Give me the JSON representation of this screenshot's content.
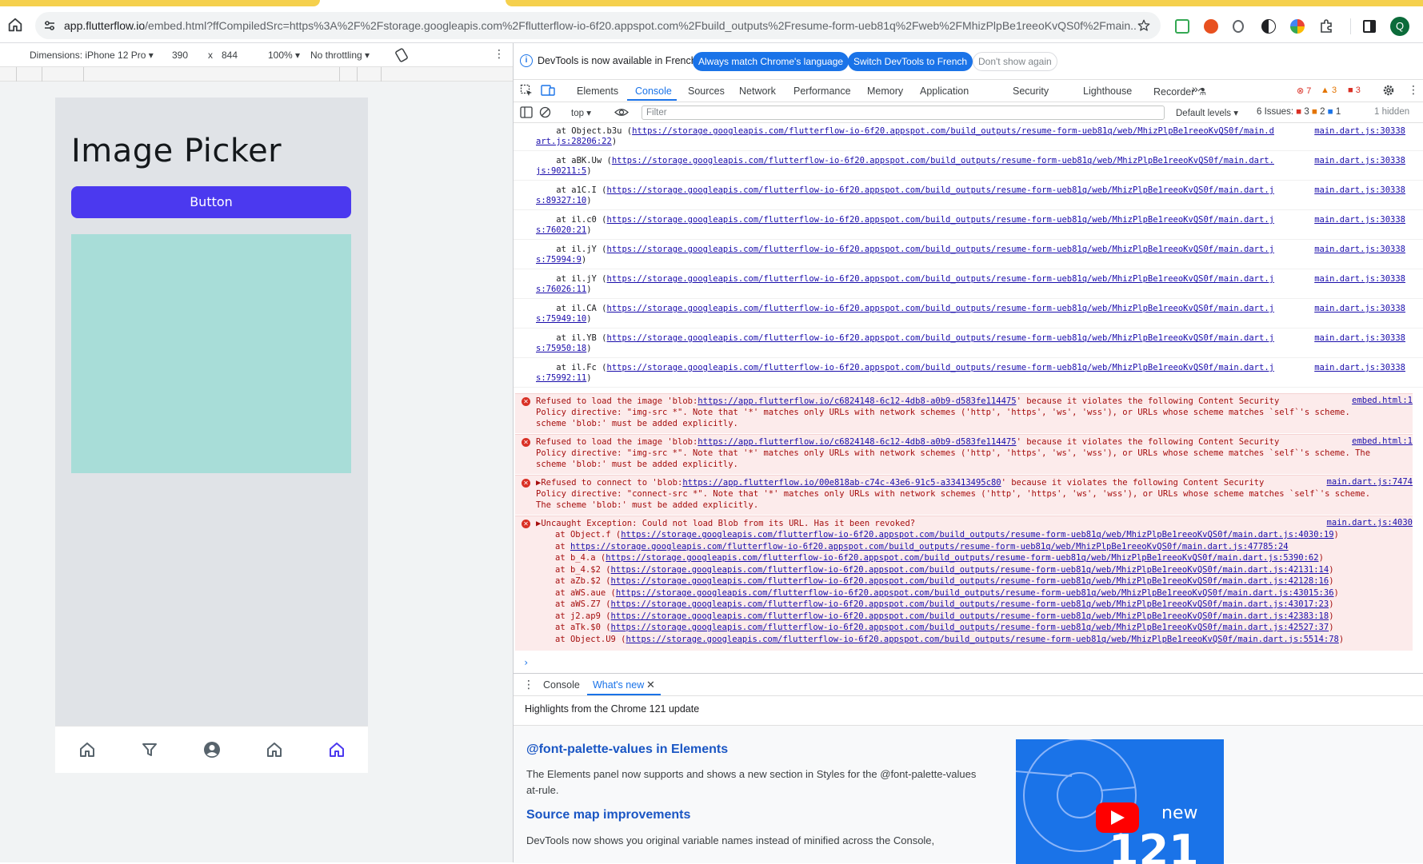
{
  "browser": {
    "url_host": "app.flutterflow.io",
    "url_rest": "/embed.html?ffCompiledSrc=https%3A%2F%2Fstorage.googleapis.com%2Fflutterflow-io-6f20.appspot.com%2Fbuild_outputs%2Fresume-form-ueb81q%2Fweb%2FMhizPlpBe1reeoKvQS0f%2Fmain....",
    "profile_initial": "Q"
  },
  "device_toolbar": {
    "dimensions_label": "Dimensions: iPhone 12 Pro",
    "width": "390",
    "times": "x",
    "height": "844",
    "zoom": "100%",
    "throttle": "No throttling"
  },
  "app": {
    "title": "Image Picker",
    "button_label": "Button",
    "nav_icons": [
      "home-icon",
      "filter-icon",
      "account-circle-icon",
      "home-icon",
      "home-icon"
    ],
    "accent_color": "#4b39ef",
    "image_bg": "#a8ddd8"
  },
  "devtools": {
    "info_message": "DevTools is now available in French!",
    "info_btn1": "Always match Chrome's language",
    "info_btn2": "Switch DevTools to French",
    "info_btn3": "Don't show again",
    "tabs": [
      "Elements",
      "Console",
      "Sources",
      "Network",
      "Performance",
      "Memory",
      "Application",
      "Security",
      "Lighthouse",
      "Recorder"
    ],
    "more_tabs": "»",
    "error_count": "7",
    "warning_count": "3",
    "issue_count": "3",
    "context": "top",
    "filter_placeholder": "Filter",
    "levels": "Default levels",
    "issues_label": "6 Issues:",
    "issues_err": "3",
    "issues_warn": "2",
    "issues_info": "1",
    "hidden": "1 hidden"
  },
  "console": {
    "traces": [
      {
        "t1": "    at Object.b3u (",
        "u1": "https://storage.googleapis.com/flutterflow-io-6f20.appspot.com/build_outputs/resume-form-ueb81q/web/MhizPlpBe1reeoKvQS0f/main.d",
        "u2": "art.js:28206:22",
        "t2": ")",
        "link": "main.dart.js:30338"
      },
      {
        "t1": "    at aBK.Uw (",
        "u1": "https://storage.googleapis.com/flutterflow-io-6f20.appspot.com/build_outputs/resume-form-ueb81q/web/MhizPlpBe1reeoKvQS0f/main.dart.",
        "u2": "js:90211:5",
        "t2": ")",
        "link": "main.dart.js:30338"
      },
      {
        "t1": "    at a1C.I (",
        "u1": "https://storage.googleapis.com/flutterflow-io-6f20.appspot.com/build_outputs/resume-form-ueb81q/web/MhizPlpBe1reeoKvQS0f/main.dart.j",
        "u2": "s:89327:10",
        "t2": ")",
        "link": "main.dart.js:30338"
      },
      {
        "t1": "    at il.c0 (",
        "u1": "https://storage.googleapis.com/flutterflow-io-6f20.appspot.com/build_outputs/resume-form-ueb81q/web/MhizPlpBe1reeoKvQS0f/main.dart.j",
        "u2": "s:76020:21",
        "t2": ")",
        "link": "main.dart.js:30338"
      },
      {
        "t1": "    at il.jY (",
        "u1": "https://storage.googleapis.com/flutterflow-io-6f20.appspot.com/build_outputs/resume-form-ueb81q/web/MhizPlpBe1reeoKvQS0f/main.dart.j",
        "u2": "s:75994:9",
        "t2": ")",
        "link": "main.dart.js:30338"
      },
      {
        "t1": "    at il.jY (",
        "u1": "https://storage.googleapis.com/flutterflow-io-6f20.appspot.com/build_outputs/resume-form-ueb81q/web/MhizPlpBe1reeoKvQS0f/main.dart.j",
        "u2": "s:76026:11",
        "t2": ")",
        "link": "main.dart.js:30338"
      },
      {
        "t1": "    at il.CA (",
        "u1": "https://storage.googleapis.com/flutterflow-io-6f20.appspot.com/build_outputs/resume-form-ueb81q/web/MhizPlpBe1reeoKvQS0f/main.dart.j",
        "u2": "s:75949:10",
        "t2": ")",
        "link": "main.dart.js:30338"
      },
      {
        "t1": "    at il.YB (",
        "u1": "https://storage.googleapis.com/flutterflow-io-6f20.appspot.com/build_outputs/resume-form-ueb81q/web/MhizPlpBe1reeoKvQS0f/main.dart.j",
        "u2": "s:75950:18",
        "t2": ")",
        "link": "main.dart.js:30338"
      },
      {
        "t1": "    at il.Fc (",
        "u1": "https://storage.googleapis.com/flutterflow-io-6f20.appspot.com/build_outputs/resume-form-ueb81q/web/MhizPlpBe1reeoKvQS0f/main.dart.j",
        "u2": "s:75992:11",
        "t2": ")",
        "link": "main.dart.js:30338"
      }
    ],
    "errors": [
      {
        "pre": "Refused to load the image 'blob:",
        "url": "https://app.flutterflow.io/c6824148-6c12-4db8-a0b9-d583fe114475",
        "post": "' because it violates the following Content Security",
        "line2": "Policy directive: \"img-src *\". Note that '*' matches only URLs with network schemes ('http', 'https', 'ws', 'wss'), or URLs whose scheme matches `self`'s scheme.",
        "line3": "scheme 'blob:' must be added explicitly.",
        "link": "embed.html:1"
      },
      {
        "pre": "Refused to load the image 'blob:",
        "url": "https://app.flutterflow.io/c6824148-6c12-4db8-a0b9-d583fe114475",
        "post": "' because it violates the following Content Security",
        "line2": "Policy directive: \"img-src *\". Note that '*' matches only URLs with network schemes ('http', 'https', 'ws', 'wss'), or URLs whose scheme matches `self`'s scheme. The",
        "line3": "scheme 'blob:' must be added explicitly.",
        "link": "embed.html:1"
      },
      {
        "pre": "▶Refused to connect to 'blob:",
        "url": "https://app.flutterflow.io/00e818ab-c74c-43e6-91c5-a33413495c80",
        "post": "' because it violates the following Content Security",
        "line2": "Policy directive: \"connect-src *\". Note that '*' matches only URLs with network schemes ('http', 'https', 'ws', 'wss'), or URLs whose scheme matches `self`'s scheme.",
        "line3": "The scheme 'blob:' must be added explicitly.",
        "link": "main.dart.js:7474"
      }
    ],
    "exception": {
      "title": "▶Uncaught Exception: Could not load Blob from its URL. Has it been revoked?",
      "link": "main.dart.js:4030",
      "stack": [
        {
          "pre": "at Object.f (",
          "url": "https://storage.googleapis.com/flutterflow-io-6f20.appspot.com/build_outputs/resume-form-ueb81q/web/MhizPlpBe1reeoKvQS0f/main.dart.js:4030:19",
          "post": ")"
        },
        {
          "pre": "at ",
          "url": "https://storage.googleapis.com/flutterflow-io-6f20.appspot.com/build_outputs/resume-form-ueb81q/web/MhizPlpBe1reeoKvQS0f/main.dart.js:47785:24",
          "post": ""
        },
        {
          "pre": "at b_4.a (",
          "url": "https://storage.googleapis.com/flutterflow-io-6f20.appspot.com/build_outputs/resume-form-ueb81q/web/MhizPlpBe1reeoKvQS0f/main.dart.js:5390:62",
          "post": ")"
        },
        {
          "pre": "at b_4.$2 (",
          "url": "https://storage.googleapis.com/flutterflow-io-6f20.appspot.com/build_outputs/resume-form-ueb81q/web/MhizPlpBe1reeoKvQS0f/main.dart.js:42131:14",
          "post": ")"
        },
        {
          "pre": "at aZb.$2 (",
          "url": "https://storage.googleapis.com/flutterflow-io-6f20.appspot.com/build_outputs/resume-form-ueb81q/web/MhizPlpBe1reeoKvQS0f/main.dart.js:42128:16",
          "post": ")"
        },
        {
          "pre": "at aWS.aue (",
          "url": "https://storage.googleapis.com/flutterflow-io-6f20.appspot.com/build_outputs/resume-form-ueb81q/web/MhizPlpBe1reeoKvQS0f/main.dart.js:43015:36",
          "post": ")"
        },
        {
          "pre": "at aWS.Z7 (",
          "url": "https://storage.googleapis.com/flutterflow-io-6f20.appspot.com/build_outputs/resume-form-ueb81q/web/MhizPlpBe1reeoKvQS0f/main.dart.js:43017:23",
          "post": ")"
        },
        {
          "pre": "at j2.ap9 (",
          "url": "https://storage.googleapis.com/flutterflow-io-6f20.appspot.com/build_outputs/resume-form-ueb81q/web/MhizPlpBe1reeoKvQS0f/main.dart.js:42383:18",
          "post": ")"
        },
        {
          "pre": "at aTk.$0 (",
          "url": "https://storage.googleapis.com/flutterflow-io-6f20.appspot.com/build_outputs/resume-form-ueb81q/web/MhizPlpBe1reeoKvQS0f/main.dart.js:42527:37",
          "post": ")"
        },
        {
          "pre": "at Object.U9 (",
          "url": "https://storage.googleapis.com/flutterflow-io-6f20.appspot.com/build_outputs/resume-form-ueb81q/web/MhizPlpBe1reeoKvQS0f/main.dart.js:5514:78",
          "post": ")"
        }
      ]
    },
    "prompt": "›"
  },
  "drawer": {
    "tab_console": "Console",
    "tab_whatsnew": "What's new",
    "highlights": "Highlights from the Chrome 121 update",
    "h1": "@font-palette-values in Elements",
    "p1": "The Elements panel now supports and shows a new section in Styles for the @font-palette-values at-rule.",
    "h2": "Source map improvements",
    "p2": "DevTools now shows you original variable names instead of minified across the Console,",
    "video_new": "new",
    "video_num": "121"
  }
}
